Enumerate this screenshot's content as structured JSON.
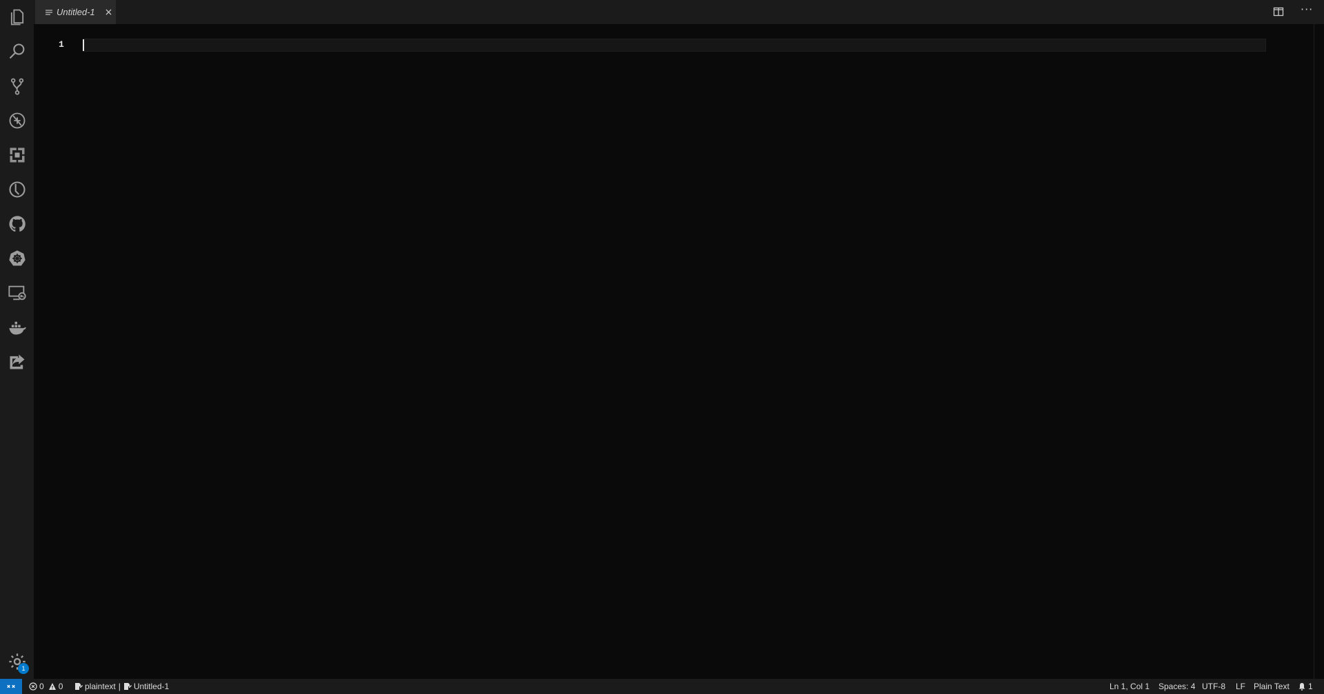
{
  "activity_bar": {
    "icons": [
      "explorer-icon",
      "search-icon",
      "source-control-icon",
      "debug-icon",
      "extensions-icon",
      "timeline-icon",
      "github-icon",
      "kubernetes-icon",
      "remote-explorer-icon",
      "docker-icon",
      "live-share-icon"
    ],
    "settings_badge": "1"
  },
  "tabs": [
    {
      "title": "Untitled-1",
      "close": "×"
    }
  ],
  "editor_actions": {
    "more": "···"
  },
  "editor": {
    "line_numbers": [
      "1"
    ]
  },
  "status_bar": {
    "errors": "0",
    "warnings": "0",
    "language_id": "plaintext",
    "separator": "|",
    "file_name": "Untitled-1",
    "position": "Ln 1, Col 1",
    "indentation": "Spaces: 4",
    "encoding": "UTF-8",
    "eol": "LF",
    "language_mode": "Plain Text",
    "notifications": "1"
  },
  "colors": {
    "accent": "#0e70c0",
    "badge": "#007acc",
    "background": "#0a0a0a"
  }
}
